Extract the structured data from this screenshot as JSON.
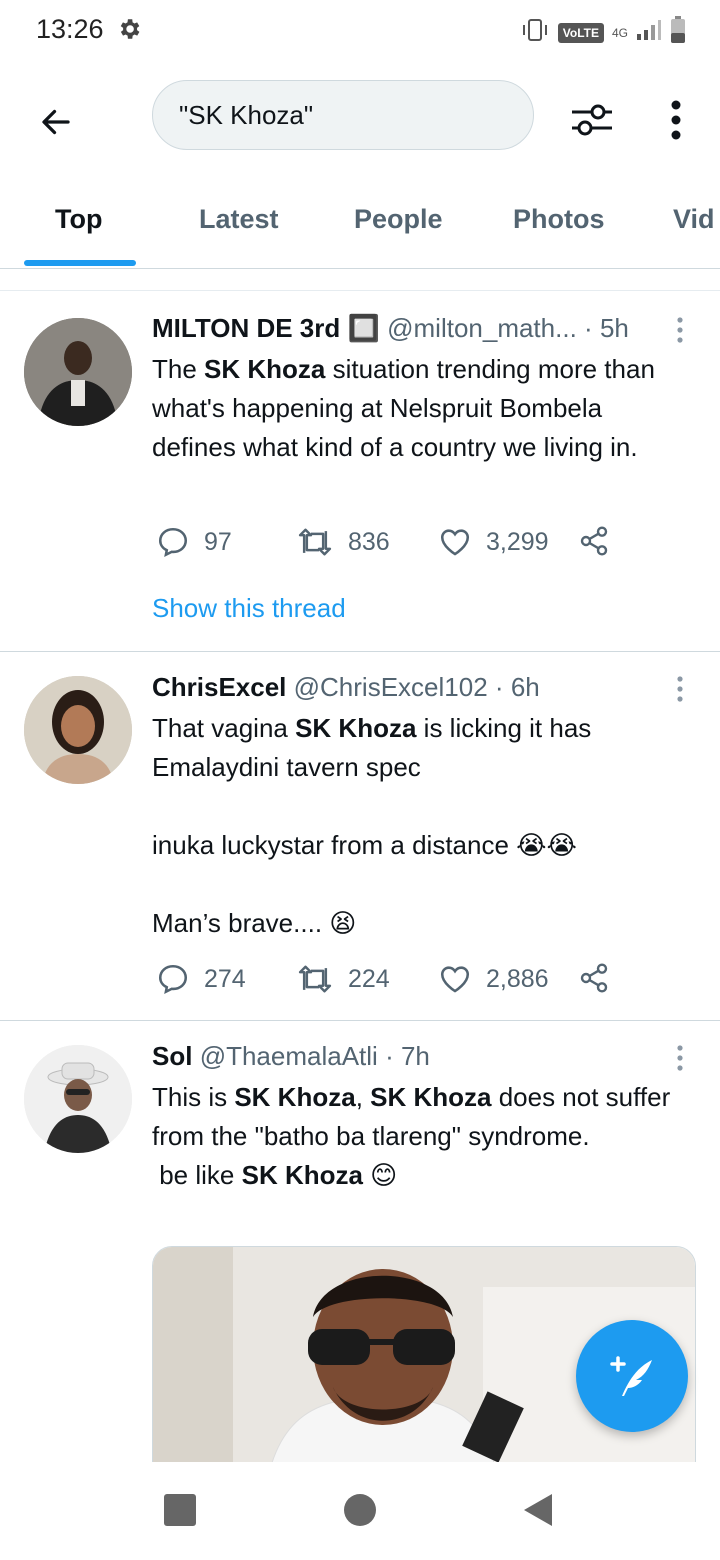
{
  "status": {
    "time": "13:26",
    "volte": "VoLTE",
    "network": "4G"
  },
  "search": {
    "query": "\"SK Khoza\""
  },
  "tabs": [
    {
      "label": "Top"
    },
    {
      "label": "Latest"
    },
    {
      "label": "People"
    },
    {
      "label": "Photos"
    },
    {
      "label": "Vid"
    }
  ],
  "tweets": [
    {
      "name": "MILTON DE 3rd 🔲",
      "handle": "@milton_math...",
      "time": "5h",
      "body": [
        "The ",
        "SK Khoza",
        " situation trending more than what's happening at Nelspruit Bombela defines what kind of a country we living in."
      ],
      "replies": "97",
      "retweets": "836",
      "likes": "3,299",
      "show_thread": "Show this thread"
    },
    {
      "name": "ChrisExcel",
      "handle": "@ChrisExcel102",
      "time": "6h",
      "body_line1": [
        "That vagina ",
        "SK Khoza",
        " is licking it has Emalaydini tavern spec"
      ],
      "body_line2": "inuka luckystar from a distance 😭😭",
      "body_line3": "Man’s brave.... 😫",
      "replies": "274",
      "retweets": "224",
      "likes": "2,886"
    },
    {
      "name": "Sol",
      "handle": "@ThaemalaAtli",
      "time": "7h",
      "body_line1": [
        "This is ",
        "SK Khoza",
        ", ",
        "SK Khoza",
        " does not suffer from the \"batho ba tlareng\" syndrome."
      ],
      "body_line2": [
        " be like ",
        "SK Khoza",
        " 😊"
      ]
    }
  ],
  "separator": "·",
  "colors": {
    "accent": "#1d9bf0",
    "text": "#0f1419",
    "secondary": "#536471"
  }
}
